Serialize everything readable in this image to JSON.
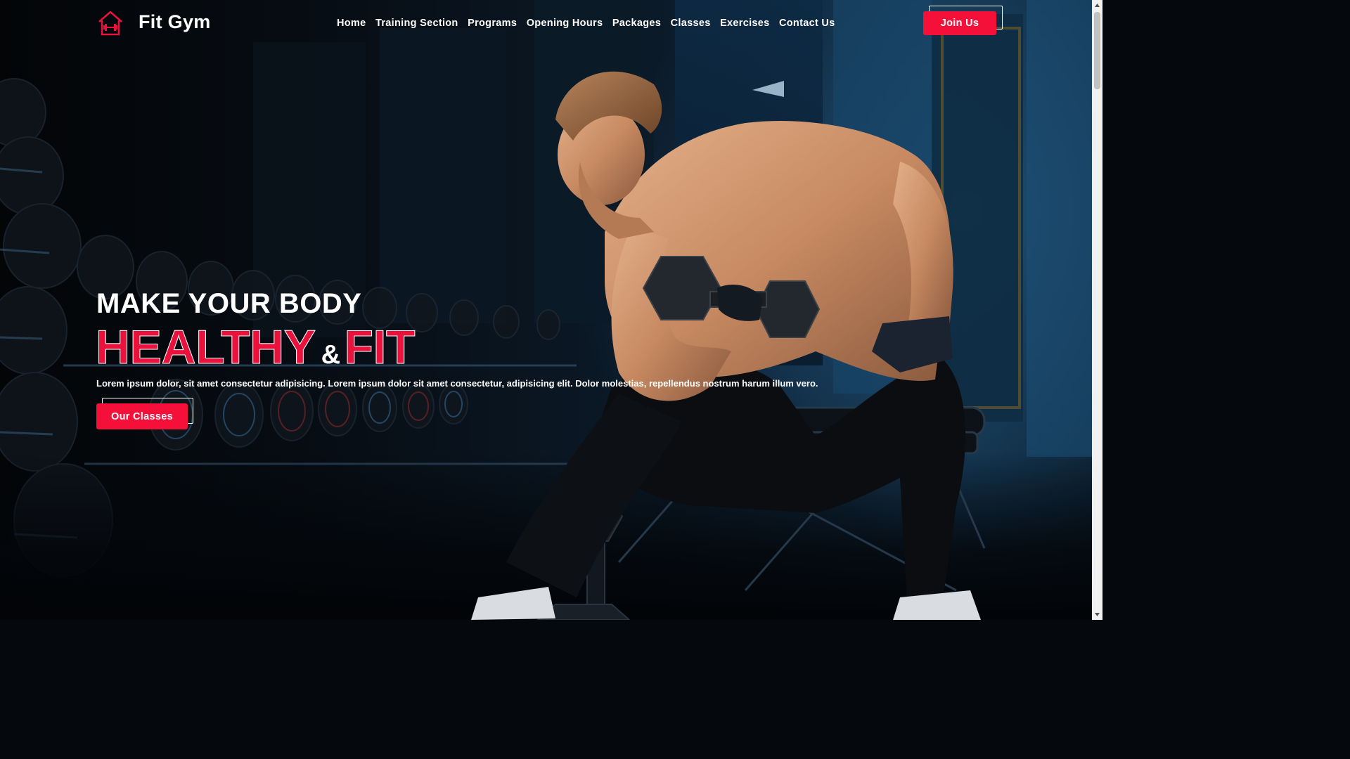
{
  "brand": {
    "name": "Fit Gym",
    "icon": "dumbbell-house-icon",
    "accent": "#f5103a"
  },
  "nav": {
    "items": [
      "Home",
      "Training Section",
      "Programs",
      "Opening Hours",
      "Packages",
      "Classes",
      "Exercises",
      "Contact Us"
    ],
    "join_label": "Join Us"
  },
  "hero": {
    "line1": "MAKE YOUR BODY",
    "word_healthy": "HEALTHY",
    "ampersand": "&",
    "word_fit": "FIT",
    "lead": "Lorem ipsum dolor, sit amet consectetur adipisicing. Lorem ipsum dolor sit amet consectetur, adipisicing elit. Dolor molestias, repellendus nostrum harum illum vero.",
    "cta_label": "Our Classes",
    "image": "man-lifting-dumbbell-photo"
  }
}
